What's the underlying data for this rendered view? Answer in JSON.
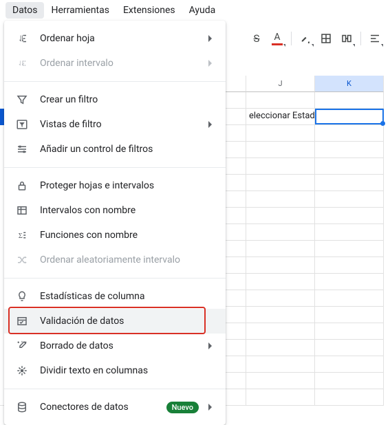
{
  "menubar": {
    "items": [
      {
        "label": "Datos",
        "active": true
      },
      {
        "label": "Herramientas"
      },
      {
        "label": "Extensiones"
      },
      {
        "label": "Ayuda"
      }
    ]
  },
  "dropdown": {
    "items": [
      {
        "icon": "sort-sheet",
        "label": "Ordenar hoja",
        "submenu": true
      },
      {
        "icon": "sort-range",
        "label": "Ordenar intervalo",
        "submenu": true,
        "disabled": true
      },
      {
        "divider": true
      },
      {
        "icon": "filter",
        "label": "Crear un filtro"
      },
      {
        "icon": "filter-views",
        "label": "Vistas de filtro",
        "submenu": true
      },
      {
        "icon": "slicer",
        "label": "Añadir un control de filtros"
      },
      {
        "divider": true
      },
      {
        "icon": "lock",
        "label": "Proteger hojas e intervalos"
      },
      {
        "icon": "named-range",
        "label": "Intervalos con nombre"
      },
      {
        "icon": "named-fn",
        "label": "Funciones con nombre"
      },
      {
        "icon": "shuffle",
        "label": "Ordenar aleatoriamente intervalo",
        "disabled": true
      },
      {
        "divider": true
      },
      {
        "icon": "bulb",
        "label": "Estadísticas de columna"
      },
      {
        "icon": "validation",
        "label": "Validación de datos",
        "hovered": true,
        "highlight": true
      },
      {
        "icon": "cleanup",
        "label": "Borrado de datos",
        "submenu": true
      },
      {
        "icon": "split",
        "label": "Dividir texto en columnas"
      },
      {
        "divider": true
      },
      {
        "icon": "connectors",
        "label": "Conectores de datos",
        "submenu": true,
        "badge": "Nuevo"
      }
    ]
  },
  "sheet": {
    "columns": [
      {
        "label": "J",
        "width": 100
      },
      {
        "label": "K",
        "width": 100,
        "selected": true
      }
    ],
    "hidden_left_width": 358,
    "rows": 19,
    "cells": {
      "1": {
        "J": "eleccionar Estado"
      }
    },
    "active_cell": "K2"
  },
  "toolbar": {
    "strike": "S",
    "textcolor": "A"
  }
}
